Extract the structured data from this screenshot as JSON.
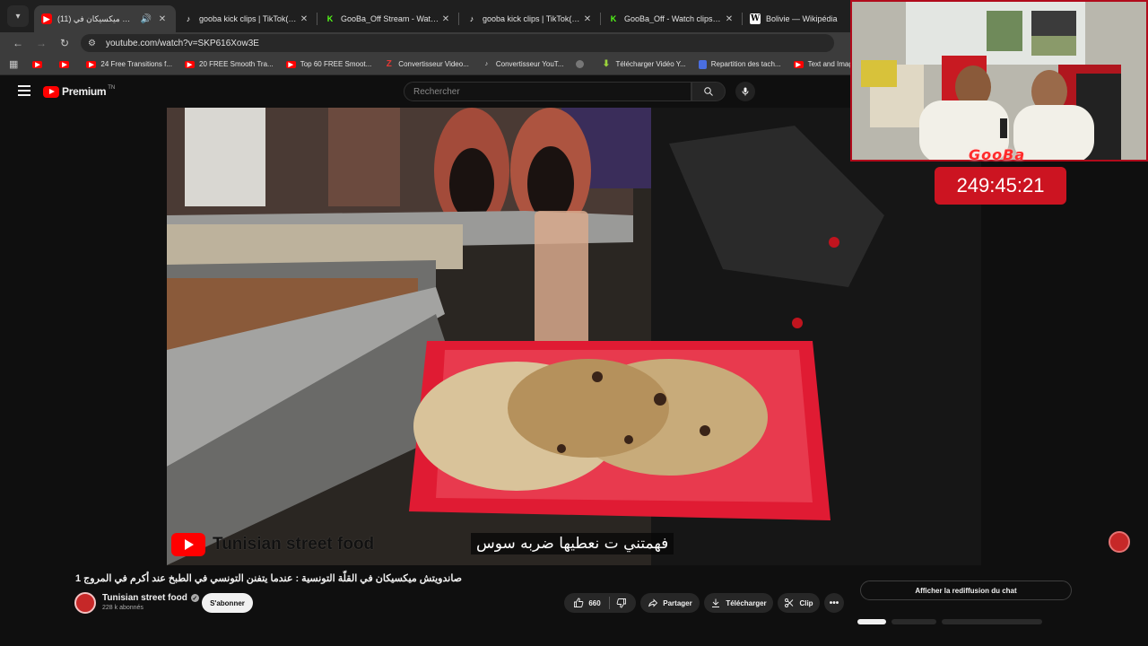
{
  "tabs": [
    {
      "icon": "youtube",
      "title": "(11) صاندويتش ميكسيكان في",
      "active": true
    },
    {
      "icon": "tiktok",
      "title": "gooba kick clips | TikTok(+99)"
    },
    {
      "icon": "kick",
      "title": "GooBa_Off Stream - Watch Live"
    },
    {
      "icon": "tiktok",
      "title": "gooba kick clips | TikTok(+99)"
    },
    {
      "icon": "kick",
      "title": "GooBa_Off - Watch clips on Kick"
    },
    {
      "icon": "wikipedia",
      "title": "Bolivie — Wikipédia"
    }
  ],
  "address": {
    "url": "youtube.com/watch?v=SKP616Xow3E"
  },
  "bookmarks": [
    {
      "icon": "youtube",
      "label": ""
    },
    {
      "icon": "youtube",
      "label": ""
    },
    {
      "icon": "youtube",
      "label": "24 Free Transitions f..."
    },
    {
      "icon": "youtube",
      "label": "20 FREE Smooth Tra..."
    },
    {
      "icon": "youtube",
      "label": "Top 60 FREE Smoot..."
    },
    {
      "icon": "z",
      "label": "Convertisseur Video..."
    },
    {
      "icon": "tiktok",
      "label": "Convertisseur YouT..."
    },
    {
      "icon": "globe",
      "label": ""
    },
    {
      "icon": "download",
      "label": "Télécharger Vidéo Y..."
    },
    {
      "icon": "doc",
      "label": "Repartition des tach..."
    },
    {
      "icon": "youtube",
      "label": "Text and Image ani..."
    }
  ],
  "youtube": {
    "brand": "Premium",
    "region": "TN",
    "search_placeholder": "Rechercher"
  },
  "video": {
    "watermark_channel": "Tunisian street food",
    "subtitle": "فهمتني ت نعطيها ضربه سوس",
    "title": "صاندويتش ميكسيكان في القلّة التونسية : عندما يتفنن التونسي في الطبخ عند أكرم في المروج 1"
  },
  "overlay": {
    "streamer_name": "GooBa",
    "timer": "249:45:21"
  },
  "channel": {
    "name": "Tunisian street food",
    "subscribers": "228 k abonnés",
    "subscribe_label": "S'abonner"
  },
  "actions": {
    "likes": "660",
    "share": "Partager",
    "download": "Télécharger",
    "clip": "Clip"
  },
  "chat": {
    "replay_label": "Afficher la rediffusion du chat"
  }
}
